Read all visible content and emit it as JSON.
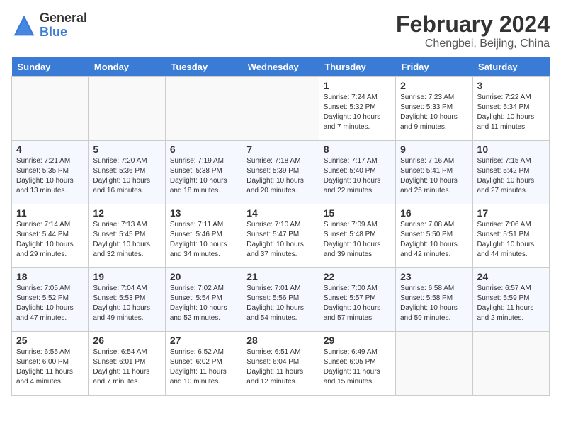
{
  "logo": {
    "general": "General",
    "blue": "Blue"
  },
  "title": "February 2024",
  "subtitle": "Chengbei, Beijing, China",
  "headers": [
    "Sunday",
    "Monday",
    "Tuesday",
    "Wednesday",
    "Thursday",
    "Friday",
    "Saturday"
  ],
  "weeks": [
    [
      {
        "day": "",
        "info": ""
      },
      {
        "day": "",
        "info": ""
      },
      {
        "day": "",
        "info": ""
      },
      {
        "day": "",
        "info": ""
      },
      {
        "day": "1",
        "info": "Sunrise: 7:24 AM\nSunset: 5:32 PM\nDaylight: 10 hours\nand 7 minutes."
      },
      {
        "day": "2",
        "info": "Sunrise: 7:23 AM\nSunset: 5:33 PM\nDaylight: 10 hours\nand 9 minutes."
      },
      {
        "day": "3",
        "info": "Sunrise: 7:22 AM\nSunset: 5:34 PM\nDaylight: 10 hours\nand 11 minutes."
      }
    ],
    [
      {
        "day": "4",
        "info": "Sunrise: 7:21 AM\nSunset: 5:35 PM\nDaylight: 10 hours\nand 13 minutes."
      },
      {
        "day": "5",
        "info": "Sunrise: 7:20 AM\nSunset: 5:36 PM\nDaylight: 10 hours\nand 16 minutes."
      },
      {
        "day": "6",
        "info": "Sunrise: 7:19 AM\nSunset: 5:38 PM\nDaylight: 10 hours\nand 18 minutes."
      },
      {
        "day": "7",
        "info": "Sunrise: 7:18 AM\nSunset: 5:39 PM\nDaylight: 10 hours\nand 20 minutes."
      },
      {
        "day": "8",
        "info": "Sunrise: 7:17 AM\nSunset: 5:40 PM\nDaylight: 10 hours\nand 22 minutes."
      },
      {
        "day": "9",
        "info": "Sunrise: 7:16 AM\nSunset: 5:41 PM\nDaylight: 10 hours\nand 25 minutes."
      },
      {
        "day": "10",
        "info": "Sunrise: 7:15 AM\nSunset: 5:42 PM\nDaylight: 10 hours\nand 27 minutes."
      }
    ],
    [
      {
        "day": "11",
        "info": "Sunrise: 7:14 AM\nSunset: 5:44 PM\nDaylight: 10 hours\nand 29 minutes."
      },
      {
        "day": "12",
        "info": "Sunrise: 7:13 AM\nSunset: 5:45 PM\nDaylight: 10 hours\nand 32 minutes."
      },
      {
        "day": "13",
        "info": "Sunrise: 7:11 AM\nSunset: 5:46 PM\nDaylight: 10 hours\nand 34 minutes."
      },
      {
        "day": "14",
        "info": "Sunrise: 7:10 AM\nSunset: 5:47 PM\nDaylight: 10 hours\nand 37 minutes."
      },
      {
        "day": "15",
        "info": "Sunrise: 7:09 AM\nSunset: 5:48 PM\nDaylight: 10 hours\nand 39 minutes."
      },
      {
        "day": "16",
        "info": "Sunrise: 7:08 AM\nSunset: 5:50 PM\nDaylight: 10 hours\nand 42 minutes."
      },
      {
        "day": "17",
        "info": "Sunrise: 7:06 AM\nSunset: 5:51 PM\nDaylight: 10 hours\nand 44 minutes."
      }
    ],
    [
      {
        "day": "18",
        "info": "Sunrise: 7:05 AM\nSunset: 5:52 PM\nDaylight: 10 hours\nand 47 minutes."
      },
      {
        "day": "19",
        "info": "Sunrise: 7:04 AM\nSunset: 5:53 PM\nDaylight: 10 hours\nand 49 minutes."
      },
      {
        "day": "20",
        "info": "Sunrise: 7:02 AM\nSunset: 5:54 PM\nDaylight: 10 hours\nand 52 minutes."
      },
      {
        "day": "21",
        "info": "Sunrise: 7:01 AM\nSunset: 5:56 PM\nDaylight: 10 hours\nand 54 minutes."
      },
      {
        "day": "22",
        "info": "Sunrise: 7:00 AM\nSunset: 5:57 PM\nDaylight: 10 hours\nand 57 minutes."
      },
      {
        "day": "23",
        "info": "Sunrise: 6:58 AM\nSunset: 5:58 PM\nDaylight: 10 hours\nand 59 minutes."
      },
      {
        "day": "24",
        "info": "Sunrise: 6:57 AM\nSunset: 5:59 PM\nDaylight: 11 hours\nand 2 minutes."
      }
    ],
    [
      {
        "day": "25",
        "info": "Sunrise: 6:55 AM\nSunset: 6:00 PM\nDaylight: 11 hours\nand 4 minutes."
      },
      {
        "day": "26",
        "info": "Sunrise: 6:54 AM\nSunset: 6:01 PM\nDaylight: 11 hours\nand 7 minutes."
      },
      {
        "day": "27",
        "info": "Sunrise: 6:52 AM\nSunset: 6:02 PM\nDaylight: 11 hours\nand 10 minutes."
      },
      {
        "day": "28",
        "info": "Sunrise: 6:51 AM\nSunset: 6:04 PM\nDaylight: 11 hours\nand 12 minutes."
      },
      {
        "day": "29",
        "info": "Sunrise: 6:49 AM\nSunset: 6:05 PM\nDaylight: 11 hours\nand 15 minutes."
      },
      {
        "day": "",
        "info": ""
      },
      {
        "day": "",
        "info": ""
      }
    ]
  ]
}
